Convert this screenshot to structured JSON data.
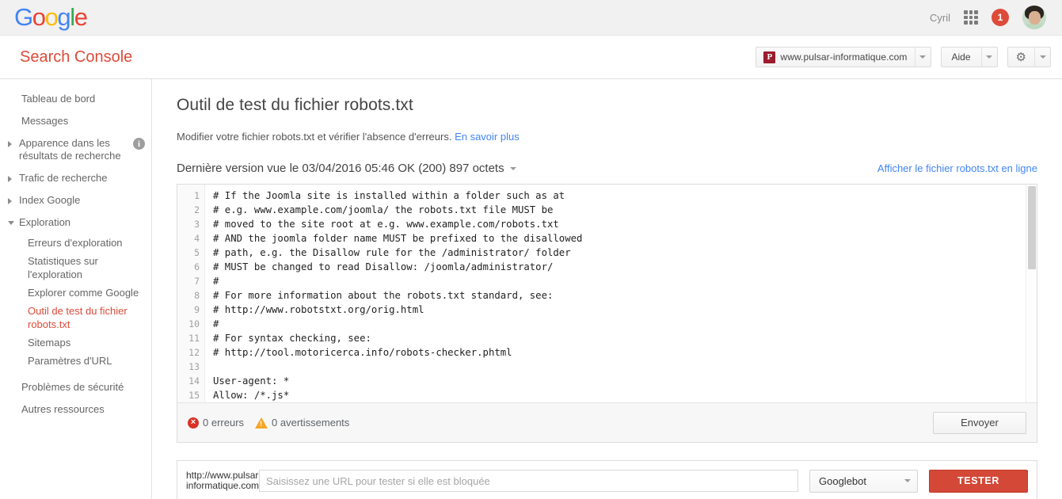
{
  "google_bar": {
    "logo_letters": [
      {
        "ch": "G",
        "color": "#4285F4"
      },
      {
        "ch": "o",
        "color": "#EA4335"
      },
      {
        "ch": "o",
        "color": "#FBBC05"
      },
      {
        "ch": "g",
        "color": "#4285F4"
      },
      {
        "ch": "l",
        "color": "#34A853"
      },
      {
        "ch": "e",
        "color": "#EA4335"
      }
    ],
    "user_name": "Cyril",
    "apps_icon": "apps-grid-icon",
    "notification_count": "1",
    "notification_color": "#dd4b39",
    "avatar_icon": "user-avatar"
  },
  "header": {
    "title": "Search Console",
    "title_color": "#dd4b39",
    "site_selector": {
      "favicon_letter": "P",
      "favicon_color": "#9c1c2c",
      "site": "www.pulsar-informatique.com"
    },
    "help_label": "Aide",
    "settings_icon": "gear-icon"
  },
  "sidebar": {
    "items": [
      {
        "label": "Tableau de bord",
        "type": "plain"
      },
      {
        "label": "Messages",
        "type": "plain"
      },
      {
        "label": "Apparence dans les résultats de recherche",
        "type": "collapsed",
        "has_info": true
      },
      {
        "label": "Trafic de recherche",
        "type": "collapsed"
      },
      {
        "label": "Index Google",
        "type": "collapsed"
      },
      {
        "label": "Exploration",
        "type": "expanded"
      }
    ],
    "sub_items": [
      {
        "label": "Erreurs d'exploration",
        "active": false
      },
      {
        "label": "Statistiques sur l'exploration",
        "active": false
      },
      {
        "label": "Explorer comme Google",
        "active": false
      },
      {
        "label": "Outil de test du fichier robots.txt",
        "active": true
      },
      {
        "label": "Sitemaps",
        "active": false
      },
      {
        "label": "Paramètres d'URL",
        "active": false
      }
    ],
    "tail_items": [
      {
        "label": "Problèmes de sécurité"
      },
      {
        "label": "Autres ressources"
      }
    ],
    "active_color": "#dd4b39"
  },
  "main": {
    "page_title": "Outil de test du fichier robots.txt",
    "subtitle_text": "Modifier votre fichier robots.txt et vérifier l'absence d'erreurs.",
    "subtitle_link": "En savoir plus",
    "version_line": "Dernière version vue le 03/04/2016 05:46 OK (200) 897 octets",
    "online_link": "Afficher le fichier robots.txt en ligne",
    "link_color": "#4285f4"
  },
  "editor": {
    "line_numbers": [
      "1",
      "2",
      "3",
      "4",
      "5",
      "6",
      "7",
      "8",
      "9",
      "10",
      "11",
      "12",
      "13",
      "14",
      "15"
    ],
    "lines": [
      "# If the Joomla site is installed within a folder such as at",
      "# e.g. www.example.com/joomla/ the robots.txt file MUST be",
      "# moved to the site root at e.g. www.example.com/robots.txt",
      "# AND the joomla folder name MUST be prefixed to the disallowed",
      "# path, e.g. the Disallow rule for the /administrator/ folder",
      "# MUST be changed to read Disallow: /joomla/administrator/",
      "#",
      "# For more information about the robots.txt standard, see:",
      "# http://www.robotstxt.org/orig.html",
      "#",
      "# For syntax checking, see:",
      "# http://tool.motoricerca.info/robots-checker.phtml",
      "",
      "User-agent: *",
      "Allow: /*.js*"
    ],
    "errors_count": "0 erreurs",
    "warnings_count": "0 avertissements",
    "error_icon": "error-circle-icon",
    "warning_icon": "warning-triangle-icon",
    "submit_label": "Envoyer"
  },
  "url_test": {
    "url_prefix": "http://www.pulsar-informatique.com/",
    "url_placeholder": "Saisissez une URL pour tester si elle est bloquée",
    "url_value": "",
    "bot_selected": "Googlebot",
    "test_label": "TESTER",
    "test_color": "#d34836"
  }
}
